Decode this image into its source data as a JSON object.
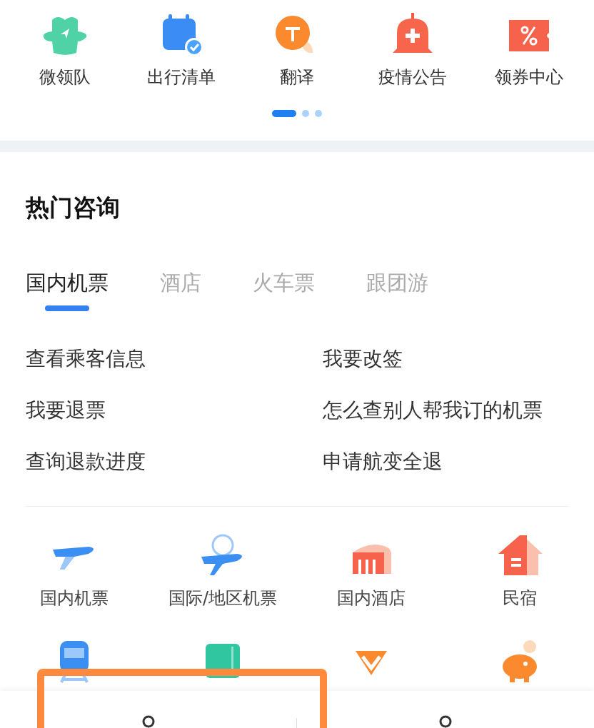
{
  "quick_tools": [
    {
      "label": "微领队"
    },
    {
      "label": "出行清单"
    },
    {
      "label": "翻译"
    },
    {
      "label": "疫情公告"
    },
    {
      "label": "领券中心"
    }
  ],
  "pager": [
    {
      "selected": true
    },
    {
      "selected": false
    },
    {
      "selected": false
    }
  ],
  "hot_consult": {
    "title": "热门咨询",
    "tabs": [
      {
        "label": "国内机票",
        "selected": true
      },
      {
        "label": "酒店",
        "selected": false
      },
      {
        "label": "火车票",
        "selected": false
      },
      {
        "label": "跟团游",
        "selected": false
      }
    ],
    "questions": [
      "查看乘客信息",
      "我要改签",
      "我要退票",
      "怎么查别人帮我订的机票",
      "查询退款进度",
      "申请航变全退"
    ]
  },
  "services": [
    {
      "kind": "labeled",
      "label": "国内机票"
    },
    {
      "kind": "labeled",
      "label": "国际/地区机票"
    },
    {
      "kind": "labeled",
      "label": "国内酒店"
    },
    {
      "kind": "labeled",
      "label": "民宿"
    },
    {
      "kind": "icon-only"
    },
    {
      "kind": "icon-only"
    },
    {
      "kind": "icon-only"
    },
    {
      "kind": "icon-only"
    }
  ],
  "bottom_bar": [
    {
      "kind": "consult"
    },
    {
      "kind": "consult"
    }
  ]
}
